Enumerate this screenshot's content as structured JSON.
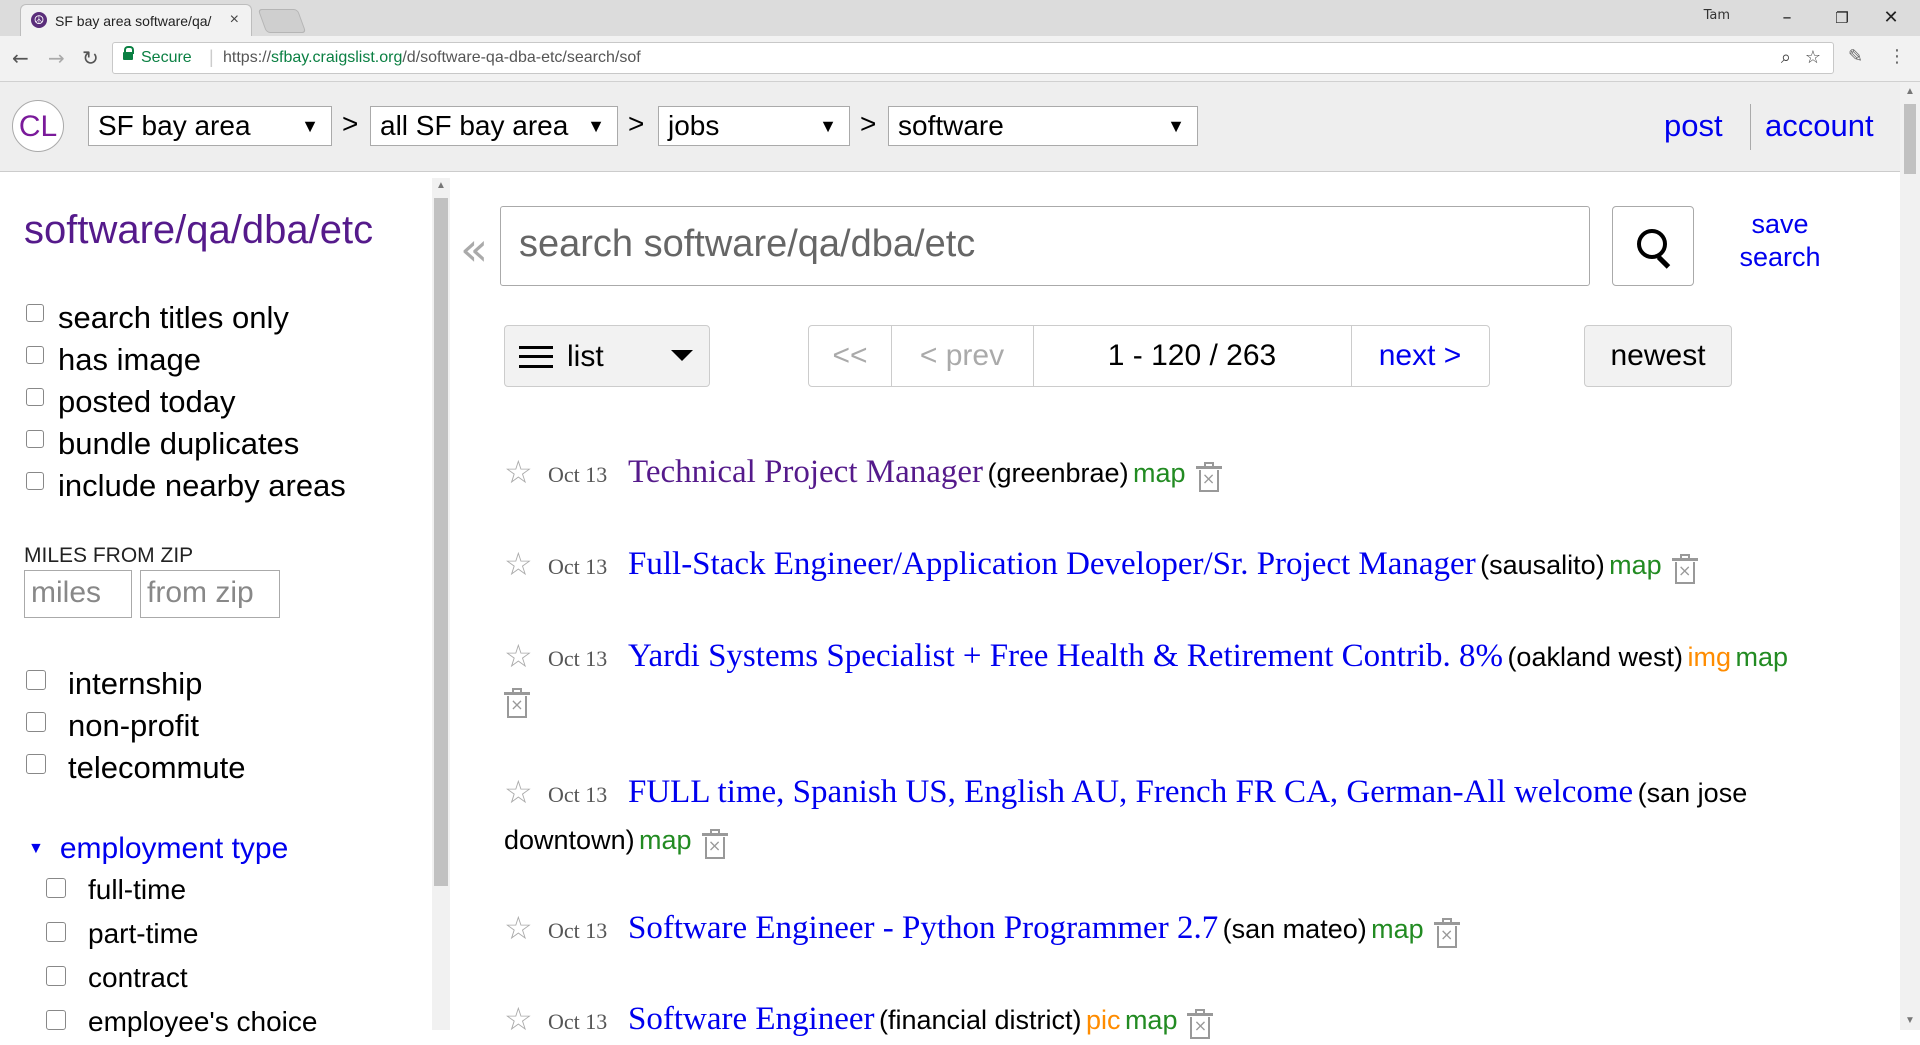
{
  "browser": {
    "tab_title": "SF bay area software/qa/",
    "tab_close": "×",
    "user": "Tam",
    "secure_label": "Secure",
    "url_scheme": "https://",
    "url_host": "sfbay.craigslist.org",
    "url_path": "/d/software-qa-dba-etc/search/sof"
  },
  "header": {
    "logo": "CL",
    "area": "SF bay area",
    "subarea": "all SF bay area",
    "category": "jobs",
    "subcategory": "software",
    "separator": ">",
    "post": "post",
    "account": "account"
  },
  "sidebar": {
    "title": "software/qa/dba/etc",
    "filters": [
      {
        "label": "search titles only",
        "checked": false
      },
      {
        "label": "has image",
        "checked": false
      },
      {
        "label": "posted today",
        "checked": false
      },
      {
        "label": "bundle duplicates",
        "checked": false
      },
      {
        "label": "include nearby areas",
        "checked": false
      }
    ],
    "miles_label": "MILES FROM ZIP",
    "miles_placeholder": "miles",
    "zip_placeholder": "from zip",
    "job_filters": [
      {
        "label": "internship",
        "checked": false
      },
      {
        "label": "non-profit",
        "checked": false
      },
      {
        "label": "telecommute",
        "checked": false
      }
    ],
    "employment_type": {
      "label": "employment type",
      "options": [
        {
          "label": "full-time",
          "checked": false
        },
        {
          "label": "part-time",
          "checked": false
        },
        {
          "label": "contract",
          "checked": false
        },
        {
          "label": "employee's choice",
          "checked": false
        }
      ]
    }
  },
  "main": {
    "collapse": "«",
    "search_placeholder": "search software/qa/dba/etc",
    "save_search": "save search",
    "view_mode": "list",
    "pager": {
      "first": "<<",
      "prev": "< prev",
      "range": "1 - 120 / 263",
      "next": "next >"
    },
    "sort": "newest"
  },
  "results": [
    {
      "date": "Oct 13",
      "title": "Technical Project Manager",
      "hood": "(greenbrae)",
      "img": "",
      "map": "map",
      "visited": true
    },
    {
      "date": "Oct 13",
      "title": "Full-Stack Engineer/Application Developer/Sr. Project Manager",
      "hood": "(sausalito)",
      "img": "",
      "map": "map",
      "visited": false
    },
    {
      "date": "Oct 13",
      "title": "Yardi Systems Specialist + Free Health & Retirement Contrib. 8%",
      "hood": "(oakland west)",
      "img": "img",
      "map": "map",
      "visited": false
    },
    {
      "date": "Oct 13",
      "title": "FULL time, Spanish US, English AU, French FR CA, German-All welcome",
      "hood": "(san jose",
      "hood_cont": "downtown)",
      "img": "",
      "map": "map",
      "visited": false
    },
    {
      "date": "Oct 13",
      "title": "Software Engineer - Python Programmer 2.7",
      "hood": "(san mateo)",
      "img": "",
      "map": "map",
      "visited": false
    },
    {
      "date": "Oct 13",
      "title": "Software Engineer",
      "hood": "(financial district)",
      "img": "pic",
      "map": "map",
      "visited": false
    }
  ],
  "colors": {
    "link": "#0000ee",
    "visited": "#551a8b",
    "map": "#228b22",
    "img": "#ff8c00"
  }
}
